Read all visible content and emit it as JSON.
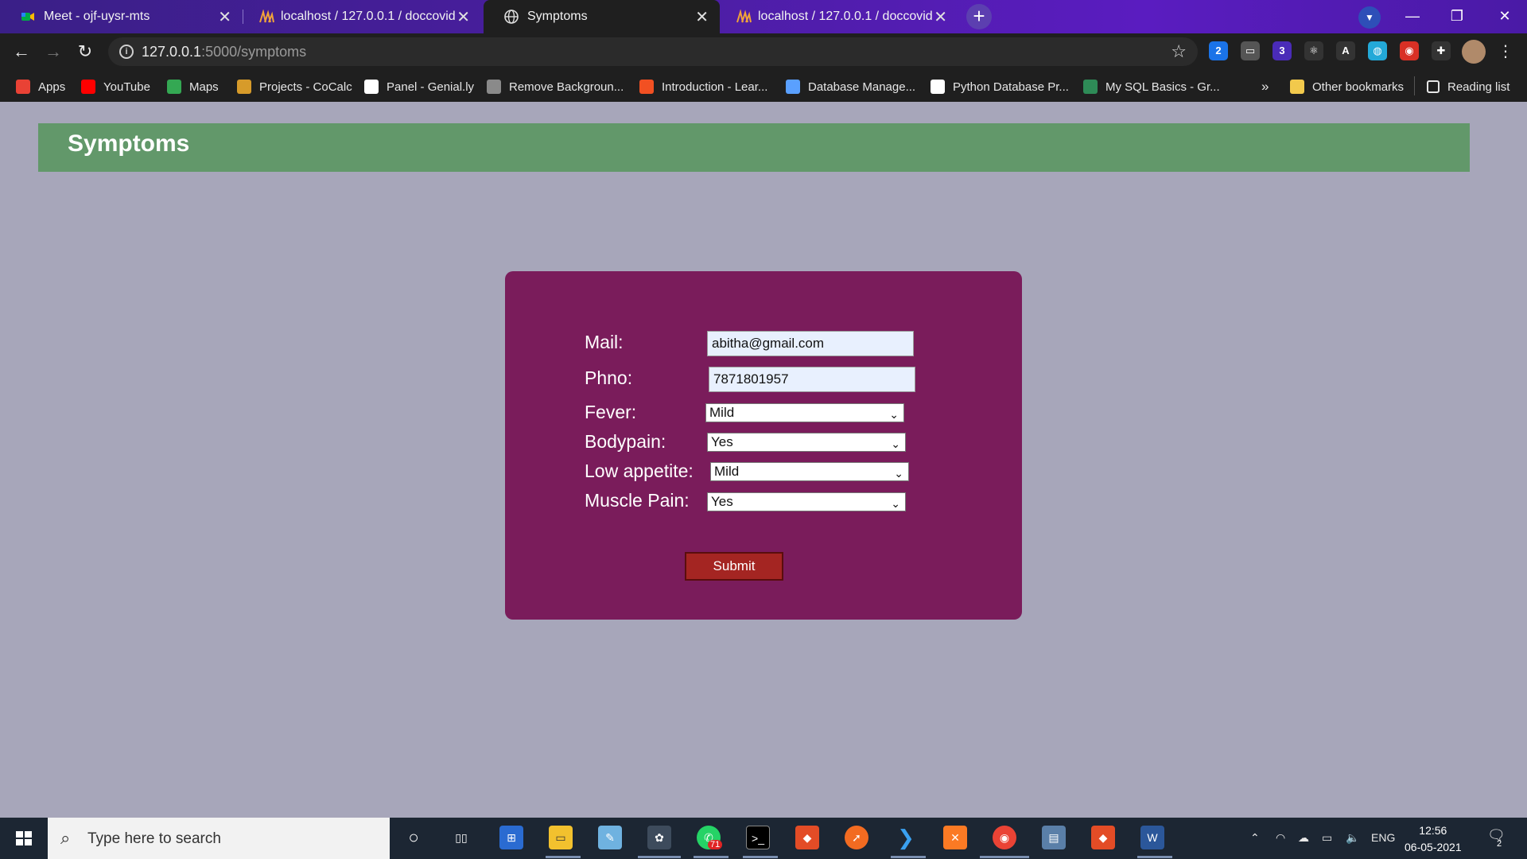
{
  "browser": {
    "tabs": [
      {
        "title": "Meet - ojf-uysr-mts",
        "active": false
      },
      {
        "title": "localhost / 127.0.0.1 / doccovid /",
        "active": false
      },
      {
        "title": "Symptoms",
        "active": true
      },
      {
        "title": "localhost / 127.0.0.1 / doccovid /",
        "active": false
      }
    ],
    "url_host": "127.0.0.1",
    "url_path": ":5000/symptoms",
    "extensions": [
      {
        "icon": "2",
        "color": "#1a73e8"
      },
      {
        "icon": "card-icon",
        "color": "#555"
      },
      {
        "icon": "3",
        "color": "#4a2bb8"
      },
      {
        "icon": "atom-icon",
        "color": "#333"
      },
      {
        "icon": "A",
        "color": "#333"
      },
      {
        "icon": "globe-icon",
        "color": "#23a9d8"
      },
      {
        "icon": "circle-icon",
        "color": "#d93025"
      },
      {
        "icon": "puzzle-icon",
        "color": "#333"
      }
    ],
    "bookmarks": [
      {
        "label": "Apps",
        "color": "#e94235"
      },
      {
        "label": "YouTube",
        "color": "#ff0000"
      },
      {
        "label": "Maps",
        "color": "#34a853"
      },
      {
        "label": "Projects - CoCalc",
        "color": "#d79b2a"
      },
      {
        "label": "Panel - Genial.ly",
        "color": "#ffffff"
      },
      {
        "label": "Remove Backgroun...",
        "color": "#8a8a8a"
      },
      {
        "label": "Introduction - Lear...",
        "color": "#f25022"
      },
      {
        "label": "Database Manage...",
        "color": "#5aa0ff"
      },
      {
        "label": "Python Database Pr...",
        "color": "#ffffff"
      },
      {
        "label": "My SQL Basics - Gr...",
        "color": "#2e8b57"
      }
    ],
    "more_bookmarks": "»",
    "other_bookmarks": "Other bookmarks",
    "reading_list": "Reading list"
  },
  "page": {
    "title": "Symptoms",
    "form": {
      "mail_label": "Mail:",
      "mail_value": "abitha@gmail.com",
      "phno_label": "Phno:",
      "phno_value": "7871801957",
      "fever_label": "Fever:",
      "fever_value": "Mild",
      "bodypain_label": "Bodypain:",
      "bodypain_value": "Yes",
      "appetite_label": "Low appetite:",
      "appetite_value": "Mild",
      "musclepain_label": "Muscle Pain:",
      "musclepain_value": "Yes",
      "submit_label": "Submit"
    }
  },
  "taskbar": {
    "search_placeholder": "Type here to search",
    "whatsapp_badge": "71",
    "language": "ENG",
    "time": "12:56",
    "date": "06-05-2021",
    "notification_count": "2"
  },
  "colors": {
    "page_bg": "#a7a6ba",
    "header_bg": "#62986a",
    "card_bg": "#7a1c5b",
    "submit_bg": "#a42522"
  }
}
